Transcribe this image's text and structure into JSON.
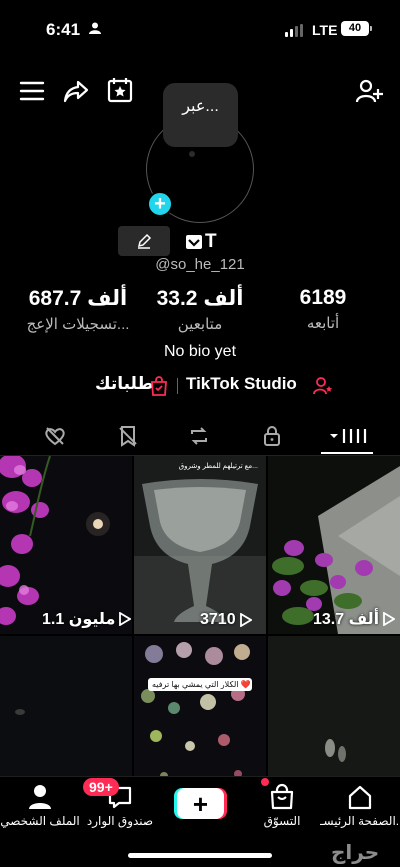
{
  "status_bar": {
    "time": "6:41",
    "network": "LTE",
    "battery": "40"
  },
  "tooltip": {
    "text": "عبر..."
  },
  "profile": {
    "name_letter": "T",
    "username": "@so_he_121",
    "bio": "No bio yet"
  },
  "stats": [
    {
      "value": "687.7 ألف",
      "label": "تسجيلات الإعج..."
    },
    {
      "value": "33.2 ألف",
      "label": "متابعين"
    },
    {
      "value": "6189",
      "label": "أتابعه"
    }
  ],
  "links": {
    "studio": "TikTok Studio",
    "orders": "طلباتك"
  },
  "tabs": [
    "liked-hidden",
    "favorites",
    "reposts",
    "private",
    "videos"
  ],
  "videos": [
    {
      "views": "1.1 مليون"
    },
    {
      "views": "3710"
    },
    {
      "views": "13.7 ألف"
    },
    {
      "views": ""
    },
    {
      "views": "",
      "caption": "الكلار التي يمشي بها ترفيه ❤️"
    },
    {
      "views": ""
    }
  ],
  "video_overlay_caption": "مع ترتيلهم للمطر وشروق...",
  "bottom_nav": {
    "profile": "الملف الشخصي",
    "inbox": "صندوق الوارد",
    "inbox_badge": "99+",
    "shop": "التسوّق",
    "home": "الصفحة الرئيسـ..."
  },
  "watermark": "حراج",
  "colors": {
    "accent_cyan": "#25f4ee",
    "accent_red": "#fe2c55",
    "add_button": "#20d5ec"
  }
}
